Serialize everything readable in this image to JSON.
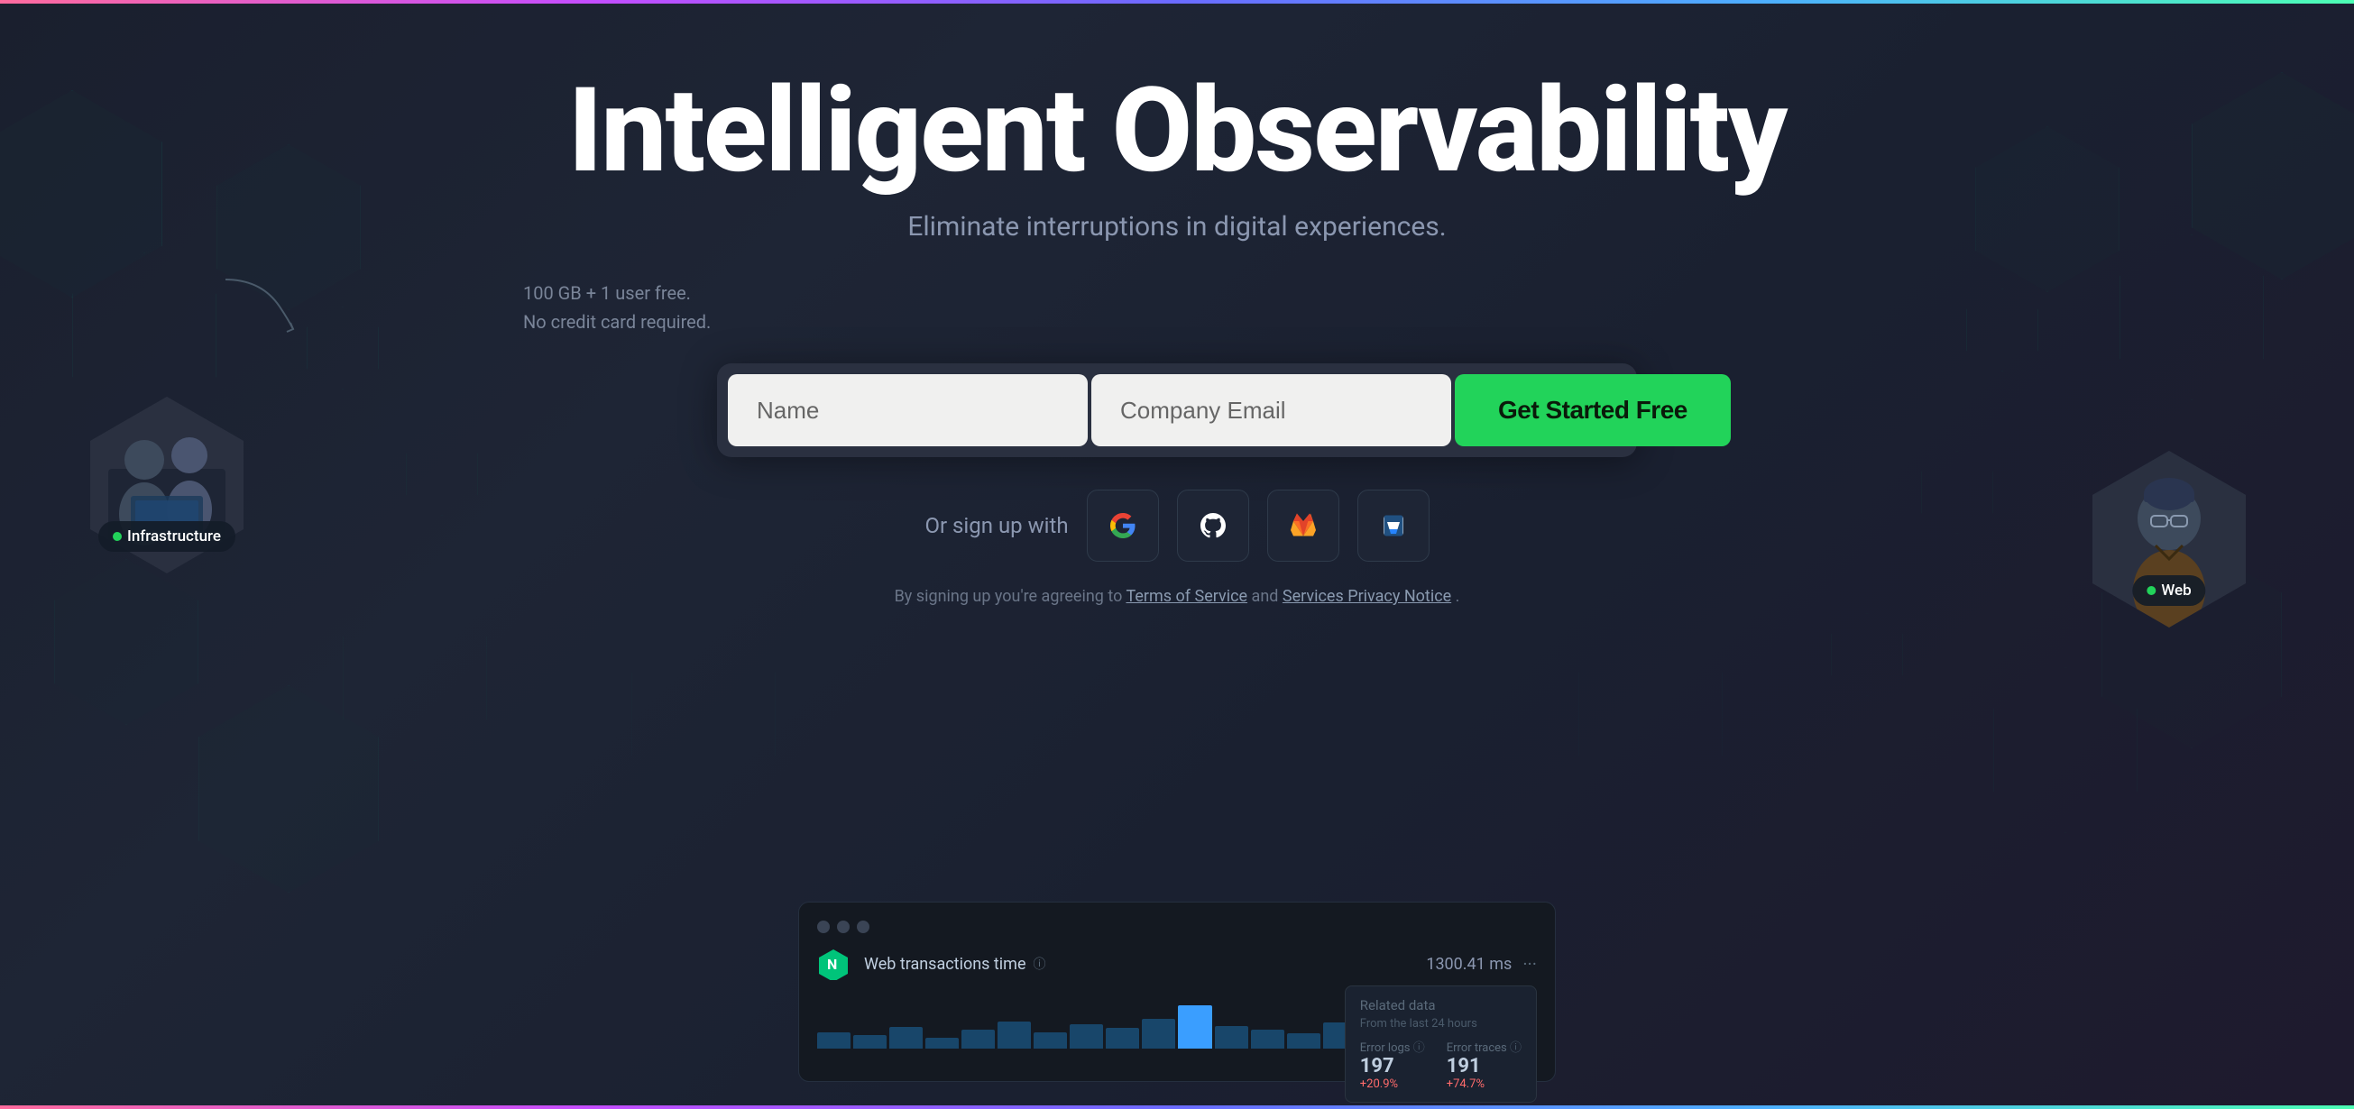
{
  "page": {
    "title": "Intelligent Observability",
    "subtitle": "Eliminate interruptions in digital experiences.",
    "free_note_line1": "100 GB + 1 user free.",
    "free_note_line2": "No credit card required.",
    "form": {
      "name_placeholder": "Name",
      "email_placeholder": "Company Email",
      "submit_label": "Get Started Free"
    },
    "social": {
      "label": "Or sign up with",
      "providers": [
        "Google",
        "GitHub",
        "GitLab",
        "Bitbucket"
      ]
    },
    "terms": {
      "prefix": "By signing up you're agreeing to ",
      "tos_label": "Terms of Service",
      "connector": " and ",
      "privacy_label": "Services Privacy Notice",
      "suffix": "."
    },
    "dashboard": {
      "metric_title": "Web transactions time",
      "metric_info": "ⓘ",
      "metric_value": "1300.41 ms",
      "related_title": "Related data",
      "related_subtitle": "From the last 24 hours",
      "metrics": [
        {
          "name": "Error logs",
          "value": "197",
          "change": "+20.9%"
        },
        {
          "name": "Error traces",
          "value": "191",
          "change": "+74.7%"
        }
      ]
    },
    "avatars": [
      {
        "label": "Infrastructure",
        "color": "#22d35a"
      },
      {
        "label": "Web",
        "color": "#22d35a"
      }
    ]
  }
}
